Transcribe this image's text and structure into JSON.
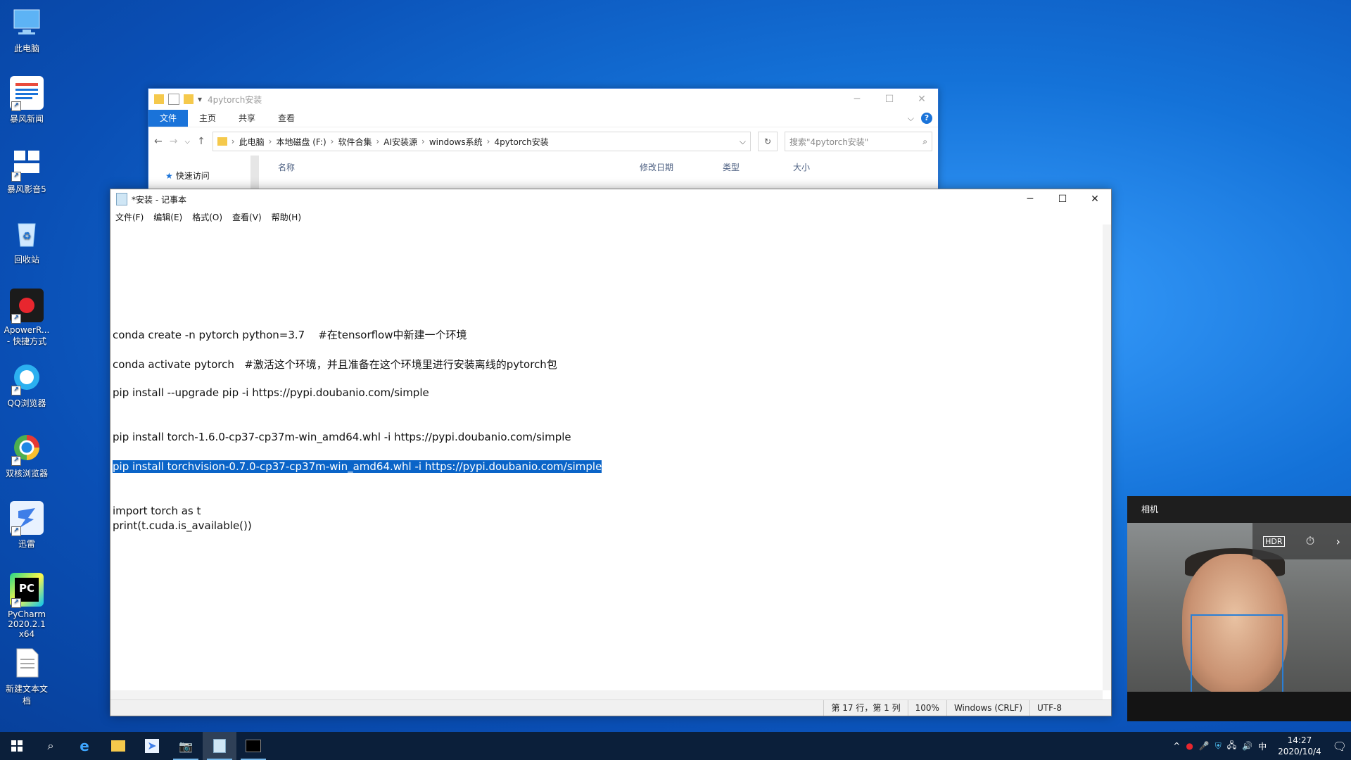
{
  "desktop_icons": [
    {
      "label": "此电脑",
      "icon": "computer-icon"
    },
    {
      "label": "暴风新闻",
      "icon": "news-icon"
    },
    {
      "label": "暴风影音5",
      "icon": "media-player-icon"
    },
    {
      "label": "回收站",
      "icon": "recycle-bin-icon"
    },
    {
      "label": "ApowerR...",
      "label2": "- 快捷方式",
      "icon": "record-icon"
    },
    {
      "label": "QQ浏览器",
      "icon": "qq-browser-icon"
    },
    {
      "label": "双核浏览器",
      "icon": "browser-icon"
    },
    {
      "label": "迅雷",
      "icon": "thunder-icon"
    },
    {
      "label": "PyCharm",
      "label2": "2020.2.1 x64",
      "icon": "pycharm-icon"
    },
    {
      "label": "新建文本文档",
      "icon": "text-document-icon"
    }
  ],
  "explorer": {
    "title": "4pytorch安装",
    "tabs": [
      "文件",
      "主页",
      "共享",
      "查看"
    ],
    "breadcrumb": [
      "此电脑",
      "本地磁盘 (F:)",
      "软件合集",
      "AI安装源",
      "windows系统",
      "4pytorch安装"
    ],
    "search_placeholder": "搜索\"4pytorch安装\"",
    "sidebar_quick_access": "快速访问",
    "columns": {
      "name": "名称",
      "modified": "修改日期",
      "type": "类型",
      "size": "大小"
    }
  },
  "notepad": {
    "title": "*安装 - 记事本",
    "menu": [
      "文件(F)",
      "编辑(E)",
      "格式(O)",
      "查看(V)",
      "帮助(H)"
    ],
    "lines": [
      "conda create -n pytorch python=3.7    #在tensorflow中新建一个环境",
      "conda activate pytorch   #激活这个环境，并且准备在这个环境里进行安装离线的pytorch包",
      "pip install --upgrade pip -i https://pypi.doubanio.com/simple",
      "pip install torch-1.6.0-cp37-cp37m-win_amd64.whl -i https://pypi.doubanio.com/simple",
      "pip install torchvision-0.7.0-cp37-cp37m-win_amd64.whl -i https://pypi.doubanio.com/simple",
      "import torch as t",
      "print(t.cuda.is_available())"
    ],
    "selected_line_index": 4,
    "status": {
      "position": "第 17 行，第 1 列",
      "zoom": "100%",
      "line_ending": "Windows (CRLF)",
      "encoding": "UTF-8"
    }
  },
  "camera": {
    "title": "相机"
  },
  "taskbar": {
    "clock_time": "14:27",
    "clock_date": "2020/10/4",
    "ime": "中"
  }
}
